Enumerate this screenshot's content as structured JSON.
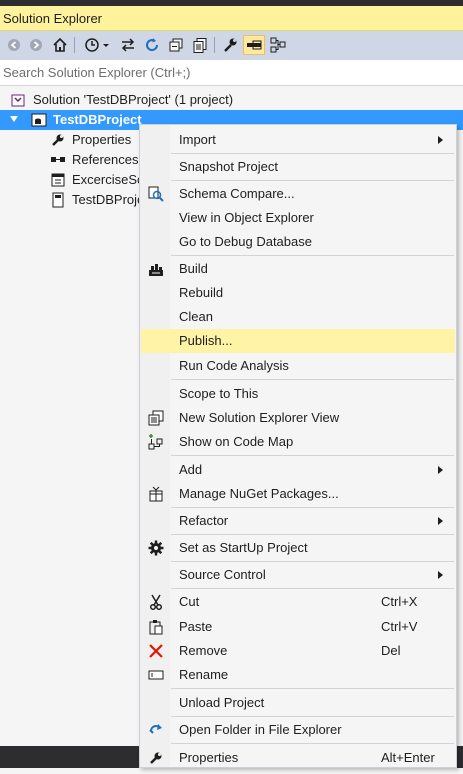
{
  "panel": {
    "title": "Solution Explorer"
  },
  "search": {
    "placeholder": "Search Solution Explorer (Ctrl+;)"
  },
  "toolbar": {
    "buttons": [
      "back-icon",
      "forward-icon",
      "home-icon",
      "pending-changes-icon",
      "sync-icon",
      "refresh-icon",
      "collapse-all-icon",
      "show-all-files-icon",
      "properties-icon",
      "preview-icon",
      "code-map-icon"
    ]
  },
  "tree": {
    "solution": "Solution 'TestDBProject' (1 project)",
    "project": "TestDBProject",
    "children": [
      "Properties",
      "References",
      "ExcerciseScl",
      "TestDBProje"
    ]
  },
  "context_menu": {
    "items": [
      {
        "label": "Import",
        "submenu": true
      },
      {
        "label": "Snapshot Project"
      },
      {
        "label": "Schema Compare...",
        "icon": "schema-compare-icon"
      },
      {
        "label": "View in Object Explorer"
      },
      {
        "label": "Go to Debug Database"
      },
      {
        "label": "Build",
        "icon": "build-icon"
      },
      {
        "label": "Rebuild"
      },
      {
        "label": "Clean"
      },
      {
        "label": "Publish...",
        "highlighted": true
      },
      {
        "label": "Run Code Analysis"
      },
      {
        "label": "Scope to This"
      },
      {
        "label": "New Solution Explorer View",
        "icon": "new-view-icon"
      },
      {
        "label": "Show on Code Map",
        "icon": "code-map-icon"
      },
      {
        "label": "Add",
        "submenu": true
      },
      {
        "label": "Manage NuGet Packages...",
        "icon": "nuget-icon"
      },
      {
        "label": "Refactor",
        "submenu": true
      },
      {
        "label": "Set as StartUp Project",
        "icon": "gear-icon"
      },
      {
        "label": "Source Control",
        "submenu": true
      },
      {
        "label": "Cut",
        "shortcut": "Ctrl+X",
        "icon": "scissors-icon"
      },
      {
        "label": "Paste",
        "shortcut": "Ctrl+V",
        "icon": "paste-icon"
      },
      {
        "label": "Remove",
        "shortcut": "Del",
        "icon": "remove-icon"
      },
      {
        "label": "Rename",
        "icon": "rename-icon"
      },
      {
        "label": "Unload Project"
      },
      {
        "label": "Open Folder in File Explorer",
        "icon": "open-folder-icon"
      },
      {
        "label": "Properties",
        "shortcut": "Alt+Enter",
        "icon": "wrench-icon"
      }
    ]
  },
  "colors": {
    "title_bg": "#fff29d",
    "toolbar_bg": "#cfd6e5",
    "selection": "#3399ff",
    "menu_highlight": "#fff3a6",
    "remove_red": "#e51400",
    "accent_blue": "#1e70c1"
  }
}
